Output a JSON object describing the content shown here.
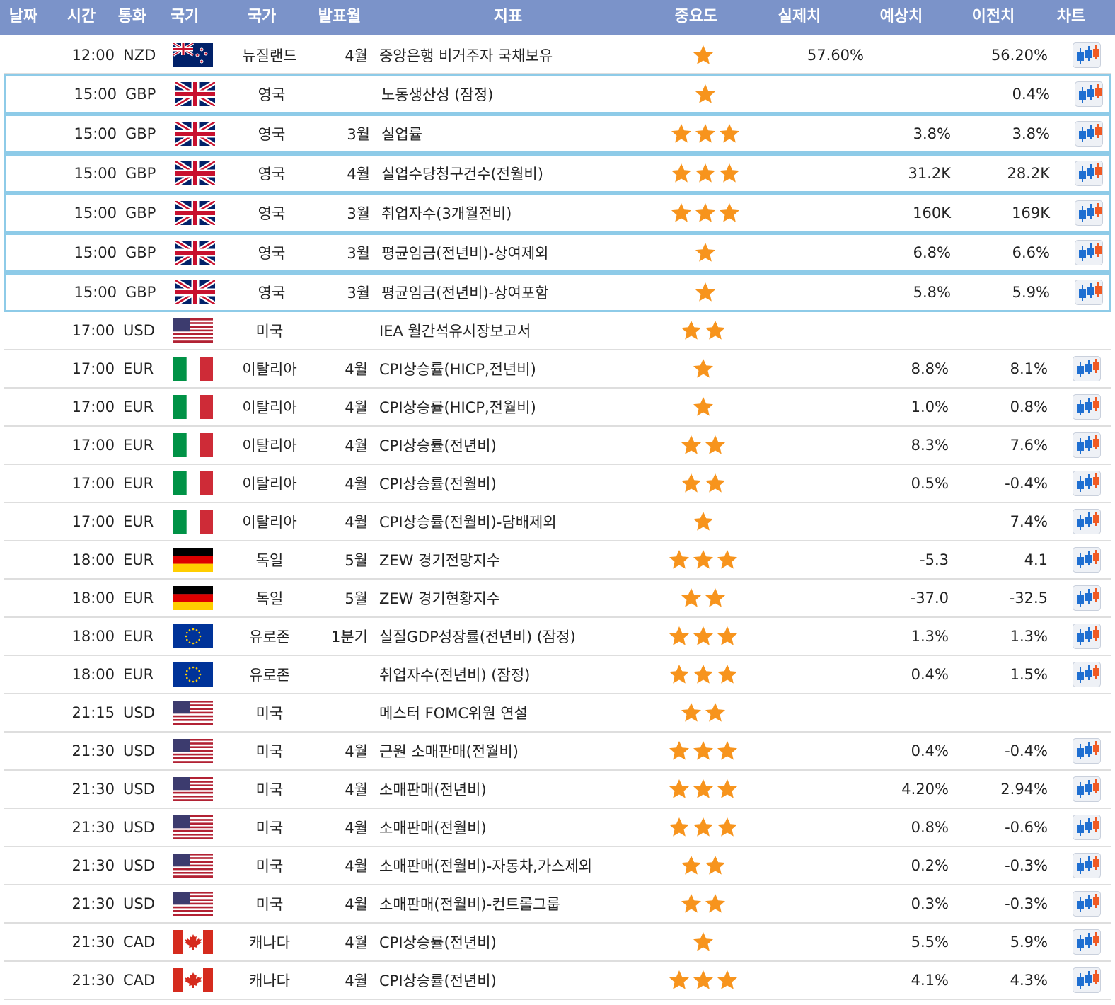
{
  "colors": {
    "header_bg": "#7b93c9",
    "highlight_border": "#8ecbe8",
    "star": "#f7941d"
  },
  "columns": [
    "날짜",
    "시간",
    "통화",
    "국기",
    "국가",
    "발표월",
    "지표",
    "중요도",
    "실제치",
    "예상치",
    "이전치",
    "차트"
  ],
  "rows": [
    {
      "time": "12:00",
      "currency": "NZD",
      "flag": "nz-flag",
      "country": "뉴질랜드",
      "month": "4월",
      "indicator": "중앙은행 비거주자 국채보유",
      "importance": 1,
      "actual": "57.60%",
      "forecast": "",
      "previous": "56.20%",
      "chart": true,
      "highlighted": false
    },
    {
      "time": "15:00",
      "currency": "GBP",
      "flag": "gb-flag",
      "country": "영국",
      "month": "",
      "indicator": "노동생산성 (잠정)",
      "importance": 1,
      "actual": "",
      "forecast": "",
      "previous": "0.4%",
      "chart": true,
      "highlighted": true
    },
    {
      "time": "15:00",
      "currency": "GBP",
      "flag": "gb-flag",
      "country": "영국",
      "month": "3월",
      "indicator": "실업률",
      "importance": 3,
      "actual": "",
      "forecast": "3.8%",
      "previous": "3.8%",
      "chart": true,
      "highlighted": true
    },
    {
      "time": "15:00",
      "currency": "GBP",
      "flag": "gb-flag",
      "country": "영국",
      "month": "4월",
      "indicator": "실업수당청구건수(전월비)",
      "importance": 3,
      "actual": "",
      "forecast": "31.2K",
      "previous": "28.2K",
      "chart": true,
      "highlighted": true
    },
    {
      "time": "15:00",
      "currency": "GBP",
      "flag": "gb-flag",
      "country": "영국",
      "month": "3월",
      "indicator": "취업자수(3개월전비)",
      "importance": 3,
      "actual": "",
      "forecast": "160K",
      "previous": "169K",
      "chart": true,
      "highlighted": true
    },
    {
      "time": "15:00",
      "currency": "GBP",
      "flag": "gb-flag",
      "country": "영국",
      "month": "3월",
      "indicator": "평균임금(전년비)-상여제외",
      "importance": 1,
      "actual": "",
      "forecast": "6.8%",
      "previous": "6.6%",
      "chart": true,
      "highlighted": true
    },
    {
      "time": "15:00",
      "currency": "GBP",
      "flag": "gb-flag",
      "country": "영국",
      "month": "3월",
      "indicator": "평균임금(전년비)-상여포함",
      "importance": 1,
      "actual": "",
      "forecast": "5.8%",
      "previous": "5.9%",
      "chart": true,
      "highlighted": true
    },
    {
      "time": "17:00",
      "currency": "USD",
      "flag": "us-flag",
      "country": "미국",
      "month": "",
      "indicator": "IEA 월간석유시장보고서",
      "importance": 2,
      "actual": "",
      "forecast": "",
      "previous": "",
      "chart": false,
      "highlighted": false
    },
    {
      "time": "17:00",
      "currency": "EUR",
      "flag": "it-flag",
      "country": "이탈리아",
      "month": "4월",
      "indicator": "CPI상승률(HICP,전년비)",
      "importance": 1,
      "actual": "",
      "forecast": "8.8%",
      "previous": "8.1%",
      "chart": true,
      "highlighted": false
    },
    {
      "time": "17:00",
      "currency": "EUR",
      "flag": "it-flag",
      "country": "이탈리아",
      "month": "4월",
      "indicator": "CPI상승률(HICP,전월비)",
      "importance": 1,
      "actual": "",
      "forecast": "1.0%",
      "previous": "0.8%",
      "chart": true,
      "highlighted": false
    },
    {
      "time": "17:00",
      "currency": "EUR",
      "flag": "it-flag",
      "country": "이탈리아",
      "month": "4월",
      "indicator": "CPI상승률(전년비)",
      "importance": 2,
      "actual": "",
      "forecast": "8.3%",
      "previous": "7.6%",
      "chart": true,
      "highlighted": false
    },
    {
      "time": "17:00",
      "currency": "EUR",
      "flag": "it-flag",
      "country": "이탈리아",
      "month": "4월",
      "indicator": "CPI상승률(전월비)",
      "importance": 2,
      "actual": "",
      "forecast": "0.5%",
      "previous": "-0.4%",
      "chart": true,
      "highlighted": false
    },
    {
      "time": "17:00",
      "currency": "EUR",
      "flag": "it-flag",
      "country": "이탈리아",
      "month": "4월",
      "indicator": "CPI상승률(전월비)-담배제외",
      "importance": 1,
      "actual": "",
      "forecast": "",
      "previous": "7.4%",
      "chart": true,
      "highlighted": false
    },
    {
      "time": "18:00",
      "currency": "EUR",
      "flag": "de-flag",
      "country": "독일",
      "month": "5월",
      "indicator": "ZEW 경기전망지수",
      "importance": 3,
      "actual": "",
      "forecast": "-5.3",
      "previous": "4.1",
      "chart": true,
      "highlighted": false
    },
    {
      "time": "18:00",
      "currency": "EUR",
      "flag": "de-flag",
      "country": "독일",
      "month": "5월",
      "indicator": "ZEW 경기현황지수",
      "importance": 2,
      "actual": "",
      "forecast": "-37.0",
      "previous": "-32.5",
      "chart": true,
      "highlighted": false
    },
    {
      "time": "18:00",
      "currency": "EUR",
      "flag": "eu-flag",
      "country": "유로존",
      "month": "1분기",
      "indicator": "실질GDP성장률(전년비) (잠정)",
      "importance": 3,
      "actual": "",
      "forecast": "1.3%",
      "previous": "1.3%",
      "chart": true,
      "highlighted": false
    },
    {
      "time": "18:00",
      "currency": "EUR",
      "flag": "eu-flag",
      "country": "유로존",
      "month": "",
      "indicator": "취업자수(전년비) (잠정)",
      "importance": 3,
      "actual": "",
      "forecast": "0.4%",
      "previous": "1.5%",
      "chart": true,
      "highlighted": false
    },
    {
      "time": "21:15",
      "currency": "USD",
      "flag": "us-flag",
      "country": "미국",
      "month": "",
      "indicator": "메스터 FOMC위원 연설",
      "importance": 2,
      "actual": "",
      "forecast": "",
      "previous": "",
      "chart": false,
      "highlighted": false
    },
    {
      "time": "21:30",
      "currency": "USD",
      "flag": "us-flag",
      "country": "미국",
      "month": "4월",
      "indicator": "근원 소매판매(전월비)",
      "importance": 3,
      "actual": "",
      "forecast": "0.4%",
      "previous": "-0.4%",
      "chart": true,
      "highlighted": false
    },
    {
      "time": "21:30",
      "currency": "USD",
      "flag": "us-flag",
      "country": "미국",
      "month": "4월",
      "indicator": "소매판매(전년비)",
      "importance": 3,
      "actual": "",
      "forecast": "4.20%",
      "previous": "2.94%",
      "chart": true,
      "highlighted": false
    },
    {
      "time": "21:30",
      "currency": "USD",
      "flag": "us-flag",
      "country": "미국",
      "month": "4월",
      "indicator": "소매판매(전월비)",
      "importance": 3,
      "actual": "",
      "forecast": "0.8%",
      "previous": "-0.6%",
      "chart": true,
      "highlighted": false
    },
    {
      "time": "21:30",
      "currency": "USD",
      "flag": "us-flag",
      "country": "미국",
      "month": "4월",
      "indicator": "소매판매(전월비)-자동차,가스제외",
      "importance": 2,
      "actual": "",
      "forecast": "0.2%",
      "previous": "-0.3%",
      "chart": true,
      "highlighted": false
    },
    {
      "time": "21:30",
      "currency": "USD",
      "flag": "us-flag",
      "country": "미국",
      "month": "4월",
      "indicator": "소매판매(전월비)-컨트롤그룹",
      "importance": 2,
      "actual": "",
      "forecast": "0.3%",
      "previous": "-0.3%",
      "chart": true,
      "highlighted": false
    },
    {
      "time": "21:30",
      "currency": "CAD",
      "flag": "ca-flag",
      "country": "캐나다",
      "month": "4월",
      "indicator": "CPI상승률(전년비)",
      "importance": 1,
      "actual": "",
      "forecast": "5.5%",
      "previous": "5.9%",
      "chart": true,
      "highlighted": false
    },
    {
      "time": "21:30",
      "currency": "CAD",
      "flag": "ca-flag",
      "country": "캐나다",
      "month": "4월",
      "indicator": "CPI상승률(전년비)",
      "importance": 3,
      "actual": "",
      "forecast": "4.1%",
      "previous": "4.3%",
      "chart": true,
      "highlighted": false
    }
  ]
}
